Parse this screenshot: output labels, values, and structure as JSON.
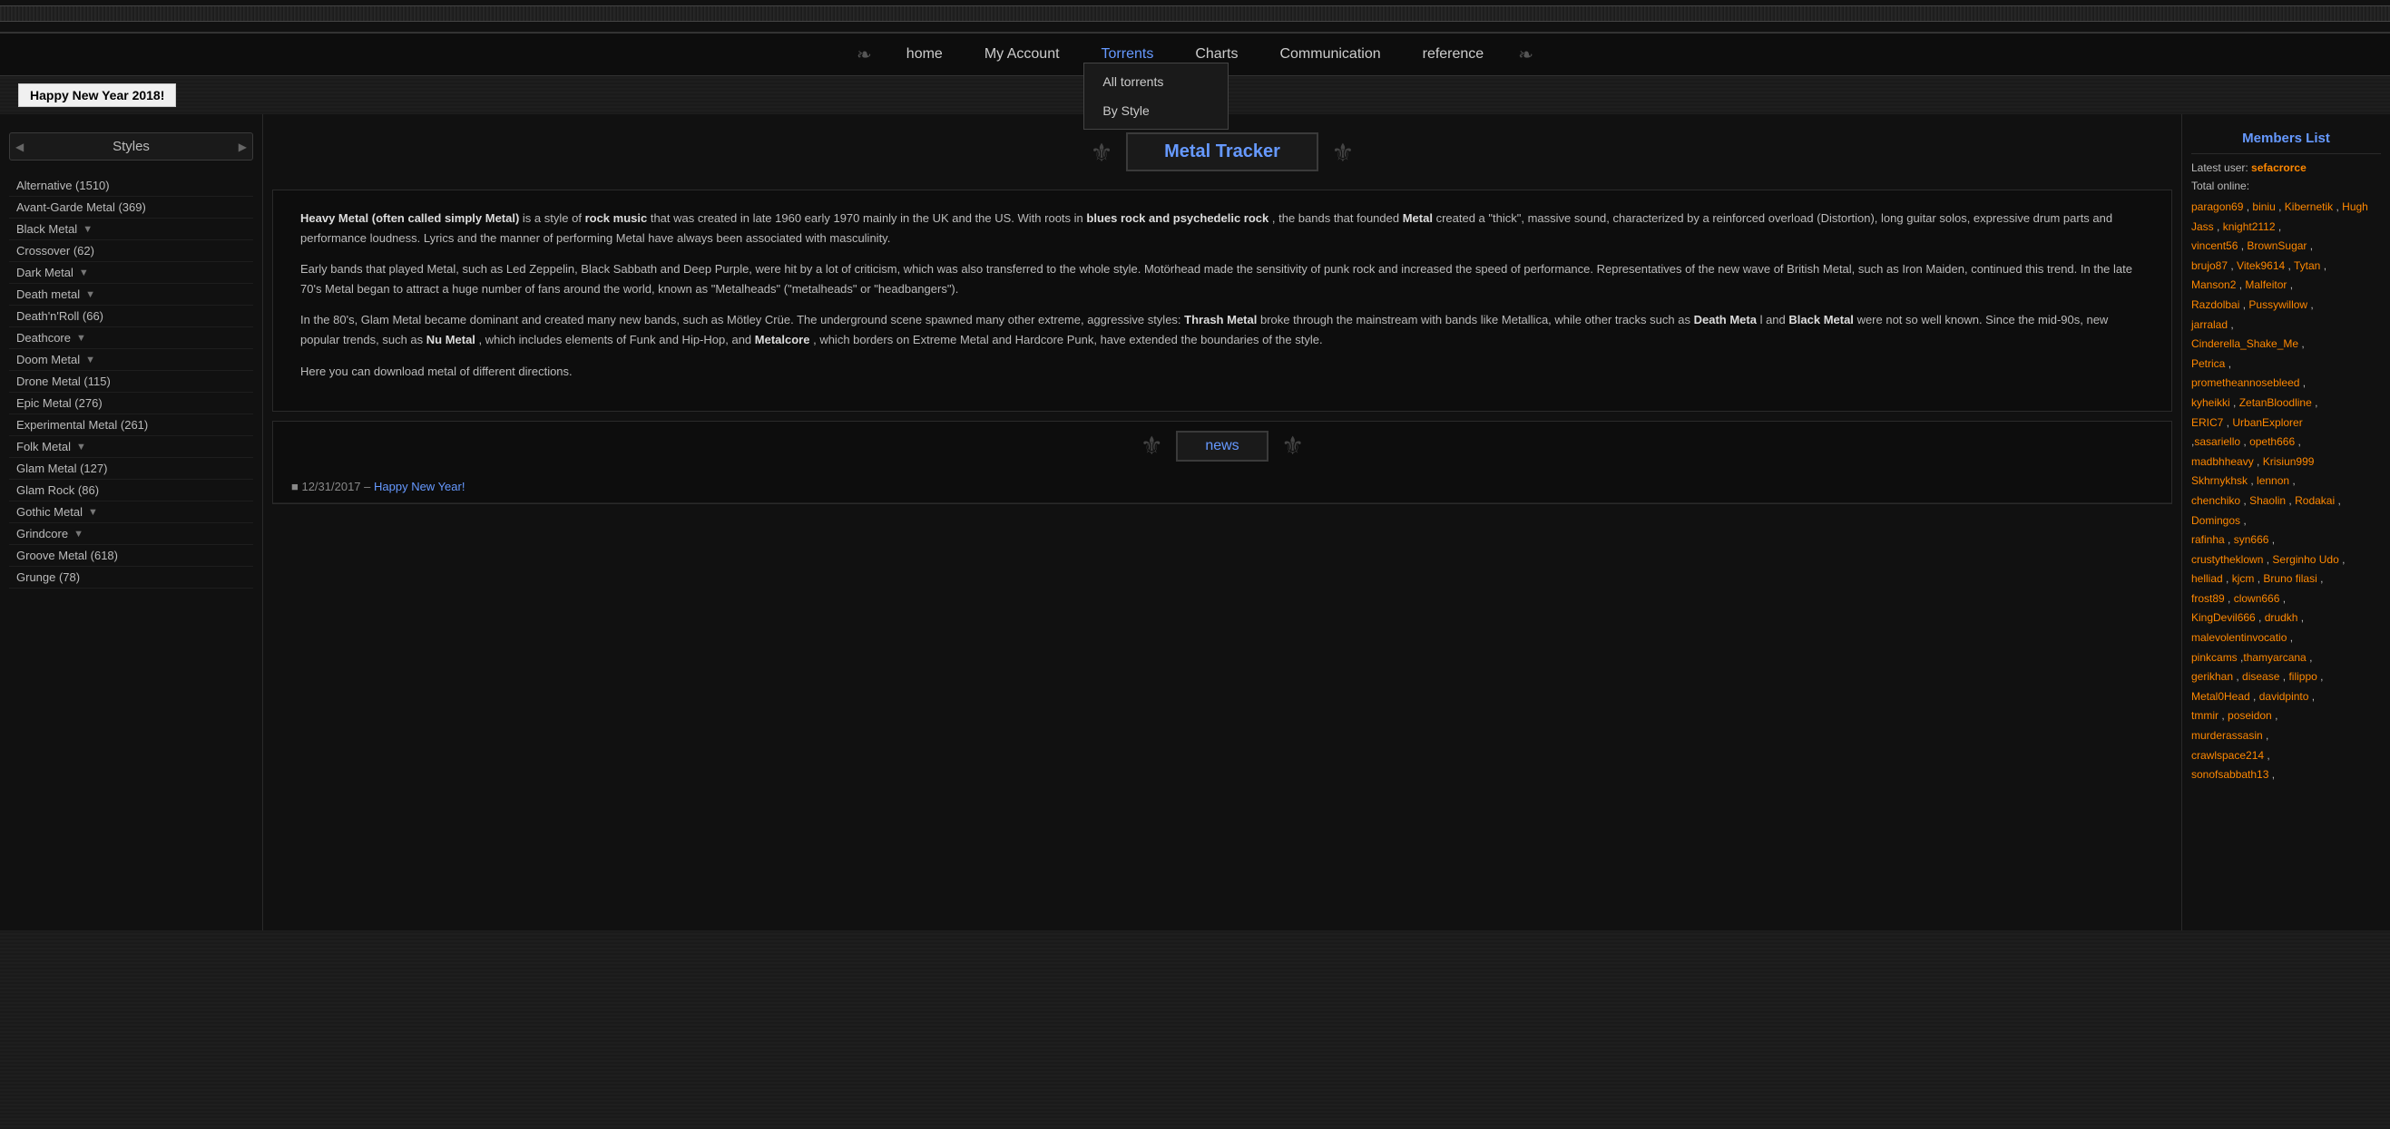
{
  "topbar": {
    "decoration": "~ ~ ~ ~ ~ ~ ~ ~ ~ ~ ~ ~ ~ ~ ~ ~ ~ ~ ~ ~ ~ ~ ~ ~ ~ ~ ~ ~ ~ ~ ~ ~ ~ ~ ~ ~ ~ ~ ~ ~ ~ ~ ~ ~ ~ ~ ~ ~ ~ ~ ~ ~ ~ ~ ~ ~ ~ ~ ~ ~"
  },
  "nav": {
    "home": "home",
    "myAccount": "My Account",
    "torrents": "Torrents",
    "charts": "Charts",
    "communication": "Communication",
    "reference": "reference",
    "dropdown": {
      "allTorrents": "All torrents",
      "byStyle": "By Style"
    }
  },
  "banner": {
    "text": "Happy New Year 2018!"
  },
  "sidebar": {
    "title": "Styles",
    "items": [
      {
        "label": "Alternative (1510)",
        "hasExpand": false
      },
      {
        "label": "Avant-Garde Metal (369)",
        "hasExpand": false
      },
      {
        "label": "Black Metal",
        "hasExpand": true
      },
      {
        "label": "Crossover (62)",
        "hasExpand": false
      },
      {
        "label": "Dark Metal",
        "hasExpand": true
      },
      {
        "label": "Death metal",
        "hasExpand": true
      },
      {
        "label": "Death'n'Roll (66)",
        "hasExpand": false
      },
      {
        "label": "Deathcore",
        "hasExpand": true
      },
      {
        "label": "Doom Metal",
        "hasExpand": true
      },
      {
        "label": "Drone Metal (115)",
        "hasExpand": false
      },
      {
        "label": "Epic Metal (276)",
        "hasExpand": false
      },
      {
        "label": "Experimental Metal (261)",
        "hasExpand": false
      },
      {
        "label": "Folk Metal",
        "hasExpand": true
      },
      {
        "label": "Glam Metal (127)",
        "hasExpand": false
      },
      {
        "label": "Glam Rock (86)",
        "hasExpand": false
      },
      {
        "label": "Gothic Metal",
        "hasExpand": true
      },
      {
        "label": "Grindcore",
        "hasExpand": true
      },
      {
        "label": "Groove Metal (618)",
        "hasExpand": false
      },
      {
        "label": "Grunge (78)",
        "hasExpand": false
      }
    ]
  },
  "siteTitle": "Metal Tracker",
  "content": {
    "para1_bold": "Heavy Metal (often called simply Metal)",
    "para1_rest": " is a style of ",
    "para1_rockmusic": "rock music",
    "para1_cont": " that was created in late 1960 early 1970 mainly in the UK and the US. With roots in ",
    "para1_blues": "blues rock and psychedelic rock",
    "para1_cont2": " , the bands that founded ",
    "para1_metal": "Metal",
    "para1_cont3": " created a \"thick\", massive sound, characterized by a reinforced overload (Distortion), long guitar solos, expressive drum parts and performance loudness. Lyrics and the manner of performing Metal have always been associated with masculinity.",
    "para2": "Early bands that played Metal, such as Led Zeppelin, Black Sabbath and Deep Purple, were hit by a lot of criticism, which was also transferred to the whole style. Motörhead made the sensitivity of punk rock and increased the speed of performance. Representatives of the new wave of British Metal, such as Iron Maiden, continued this trend. In the late 70's Metal began to attract a huge number of fans around the world, known as \"Metalheads\" (\"metalheads\" or \"headbangers\").",
    "para3_start": "In the 80's, Glam Metal became dominant and created many new bands, such as Mötley Crüe. The underground scene spawned many other extreme, aggressive styles: ",
    "para3_thrash": "Thrash Metal",
    "para3_cont": " broke through the mainstream with bands like Metallica, while other tracks such as ",
    "para3_death": "Death Meta",
    "para3_cont2": "l and ",
    "para3_black": "Black Metal",
    "para3_cont3": " were not so well known. Since the mid-90s, new popular trends, such as ",
    "para3_nu": "Nu Metal",
    "para3_cont4": " , which includes elements of Funk and Hip-Hop, and ",
    "para3_metalcore": "Metalcore",
    "para3_cont5": " , which borders on Extreme Metal and Hardcore Punk, have extended the boundaries of the style.",
    "para4": "Here you can download metal of different directions."
  },
  "news": {
    "title": "news",
    "items": [
      {
        "date": "12/31/2017",
        "link": "Happy New Year!"
      }
    ]
  },
  "members": {
    "title": "Members List",
    "latestLabel": "Latest user:",
    "latestUser": "sefacrorce",
    "totalOnlineLabel": "Total online:",
    "onlineUsers": [
      "paragon69",
      "biniu",
      "Kibernetik",
      "Hugh Jass",
      "knight2112",
      "vincent56",
      "BrownSugar",
      "brujo87",
      "Vitek9614",
      "Tytan",
      "Manson2",
      "Malfeitor",
      "Razdolbai",
      "Pussywillow",
      "jarralad",
      "Cinderella_Shake_Me",
      "Petrica",
      "prometheannosebleed",
      "kyheikki",
      "ZetanBloodline",
      "ERIC7",
      "UrbanExplorer",
      "sasariello",
      "opeth666",
      "madbhheavy",
      "Krisiun999",
      "Skhrnykhsk",
      "lennon",
      "chenchiko",
      "Shaolin",
      "Rodakai",
      "Domingos",
      "rafinha",
      "syn666",
      "crustytheklown",
      "Serginho Udo",
      "helliad",
      "kjcm",
      "Bruno filasi",
      "frost89",
      "clown666",
      "KingDevil666",
      "drudkh",
      "malevolentinvocatio",
      "pinkcams",
      "thamyarcana",
      "gerikhan",
      "disease",
      "filippo",
      "Metal0Head",
      "davidpinto",
      "tmmir",
      "poseidon",
      "murderassasin",
      "crawlspace214",
      "sonofsabbath13"
    ]
  }
}
